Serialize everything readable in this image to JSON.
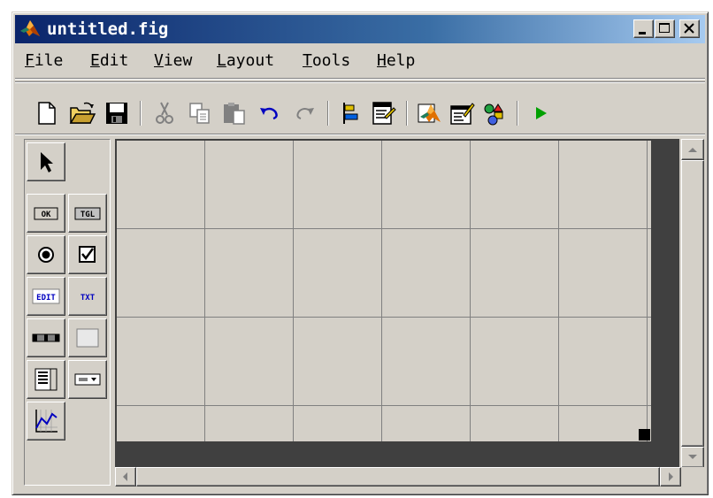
{
  "window": {
    "title": "untitled.fig",
    "title_gradient_start": "#0a246a",
    "title_gradient_end": "#a6caf0",
    "face_color": "#d4d0c8"
  },
  "caption_buttons": [
    {
      "name": "minimize",
      "icon": "minimize-icon"
    },
    {
      "name": "maximize",
      "icon": "maximize-icon"
    },
    {
      "name": "close",
      "icon": "close-icon"
    }
  ],
  "menu": {
    "items": [
      {
        "key": "F",
        "rest": "ile"
      },
      {
        "key": "E",
        "rest": "dit"
      },
      {
        "key": "V",
        "rest": "iew"
      },
      {
        "key": "L",
        "rest": "ayout"
      },
      {
        "key": "T",
        "rest": "ools"
      },
      {
        "key": "H",
        "rest": "elp"
      }
    ]
  },
  "toolbar": {
    "buttons": [
      "new-file-icon",
      "open-folder-icon",
      "save-icon",
      "cut-icon",
      "copy-icon",
      "paste-icon",
      "undo-icon",
      "redo-icon",
      "align-objects-icon",
      "menu-editor-icon",
      "matlab-logo-icon",
      "property-inspector-icon",
      "object-browser-icon",
      "run-icon"
    ]
  },
  "palette": {
    "buttons": [
      {
        "name": "select",
        "icon": "arrow-cursor-icon"
      },
      {
        "name": "push-button",
        "icon": "push-button-icon",
        "text": "OK"
      },
      {
        "name": "toggle-button",
        "icon": "toggle-button-icon",
        "text": "TGL"
      },
      {
        "name": "radio-button",
        "icon": "radio-button-icon"
      },
      {
        "name": "checkbox",
        "icon": "checkbox-icon"
      },
      {
        "name": "edit-text",
        "icon": "edit-text-icon",
        "text": "EDIT"
      },
      {
        "name": "static-text",
        "icon": "static-text-icon",
        "text": "TXT"
      },
      {
        "name": "slider",
        "icon": "slider-icon"
      },
      {
        "name": "frame",
        "icon": "frame-icon"
      },
      {
        "name": "listbox",
        "icon": "listbox-icon"
      },
      {
        "name": "popup-menu",
        "icon": "popup-menu-icon"
      },
      {
        "name": "axes",
        "icon": "axes-icon"
      }
    ]
  },
  "colors": {
    "grid_line": "#808080",
    "canvas_border": "#404040",
    "run_green": "#00a000",
    "matlab_orange": "#e07000"
  }
}
